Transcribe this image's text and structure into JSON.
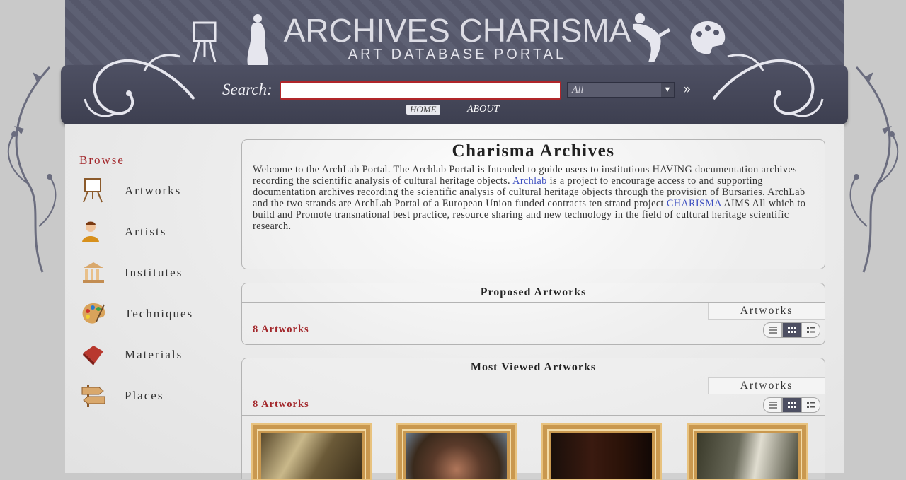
{
  "header": {
    "title": "ARCHIVES CHARISMA",
    "subtitle": "ART DATABASE PORTAL",
    "search_label": "Search:",
    "search_value": "",
    "search_scope": "All",
    "search_go": "»",
    "nav": {
      "home": "HOME",
      "about": "ABOUT"
    },
    "icons": [
      "easel-icon",
      "statue-icon",
      "discus-thrower-icon",
      "palette-icon"
    ]
  },
  "sidebar": {
    "title": "Browse",
    "items": [
      {
        "label": "Artworks",
        "icon": "easel-icon"
      },
      {
        "label": "Artists",
        "icon": "person-icon"
      },
      {
        "label": "Institutes",
        "icon": "museum-icon"
      },
      {
        "label": "Techniques",
        "icon": "palette-icon"
      },
      {
        "label": "Materials",
        "icon": "material-icon"
      },
      {
        "label": "Places",
        "icon": "signpost-icon"
      }
    ]
  },
  "main": {
    "title": "Charisma Archives",
    "intro": {
      "part1": "Welcome to the ArchLab Portal. The Archlab Portal is Intended to guide users to institutions HAVING documentation archives recording the scientific analysis of cultural heritage objects. ",
      "link1": "Archlab",
      "part2": " is a project to encourage access to and supporting documentation archives recording the scientific analysis of cultural heritage objects through the provision of Bursaries. ArchLab and the two strands are ArchLab Portal of a European Union funded contracts ten strand project ",
      "link2": "CHARISMA",
      "part3": " AIMS All which to build and Promote transnational best practice, resource sharing and new technology in the field of cultural heritage scientific research."
    },
    "sections": [
      {
        "title": "Proposed Artworks",
        "tab": "Artworks",
        "count": "8 Artworks"
      },
      {
        "title": "Most Viewed Artworks",
        "tab": "Artworks",
        "count": "8 Artworks"
      }
    ],
    "view_modes": [
      "list-view-icon",
      "grid-view-icon",
      "detail-view-icon"
    ],
    "active_view": "grid-view-icon",
    "colors": {
      "accent": "#a2262a",
      "link": "#3d4fc0",
      "header": "#4e5063"
    }
  }
}
